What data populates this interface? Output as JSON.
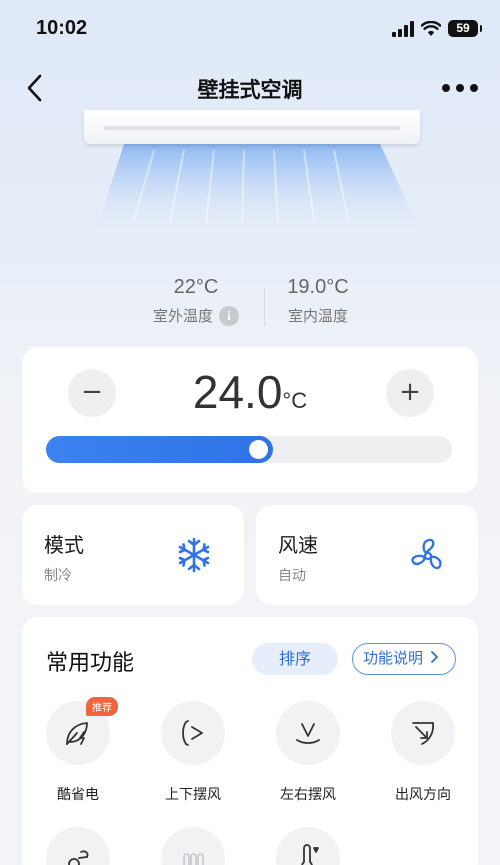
{
  "status_bar": {
    "time": "10:02",
    "battery": "59"
  },
  "nav": {
    "title": "壁挂式空调"
  },
  "temperatures": {
    "outdoor": {
      "value": "22°C",
      "label": "室外温度"
    },
    "indoor": {
      "value": "19.0°C",
      "label": "室内温度"
    }
  },
  "setpoint": {
    "value": "24.0",
    "unit": "°C",
    "minus_label": "−",
    "plus_label": "+",
    "slider_fraction": 0.56
  },
  "mode": {
    "title": "模式",
    "value": "制冷"
  },
  "wind": {
    "title": "风速",
    "value": "自动"
  },
  "functions": {
    "title": "常用功能",
    "sort_label": "排序",
    "help_label": "功能说明",
    "items": [
      {
        "label": "酷省电",
        "badge": "推荐"
      },
      {
        "label": "上下摆风"
      },
      {
        "label": "左右摆风"
      },
      {
        "label": "出风方向"
      }
    ]
  },
  "colors": {
    "accent": "#2f73e6",
    "badge": "#f0643f"
  }
}
